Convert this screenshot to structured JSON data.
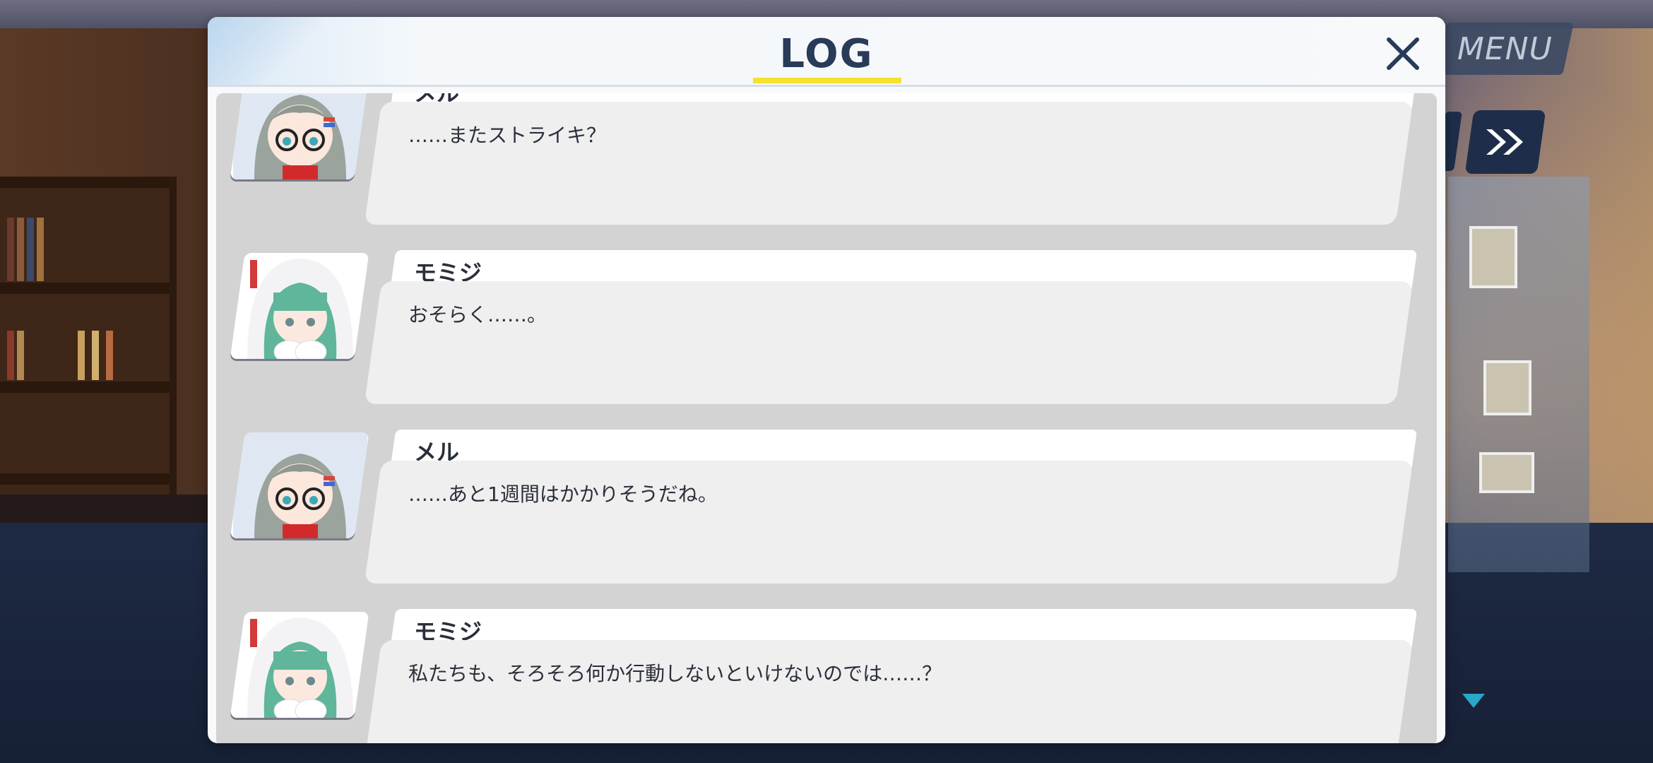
{
  "hud": {
    "menu_label": "MENU",
    "skip_icon": "double-chevron-right-icon",
    "scroll_indicator_icon": "triangle-down-icon"
  },
  "log": {
    "title": "LOG",
    "close_icon": "close-icon",
    "accent_color": "#f4e22e",
    "title_color": "#283b58",
    "entries": [
      {
        "speaker": "メル",
        "text": "……またストライキ？",
        "avatar": "mel-avatar"
      },
      {
        "speaker": "モミジ",
        "text": "おそらく……。",
        "avatar": "momiji-avatar"
      },
      {
        "speaker": "メル",
        "text": "……あと1週間はかかりそうだね。",
        "avatar": "mel-avatar"
      },
      {
        "speaker": "モミジ",
        "text": "私たちも、そろそろ何か行動しないといけないのでは……？",
        "avatar": "momiji-avatar"
      }
    ]
  }
}
